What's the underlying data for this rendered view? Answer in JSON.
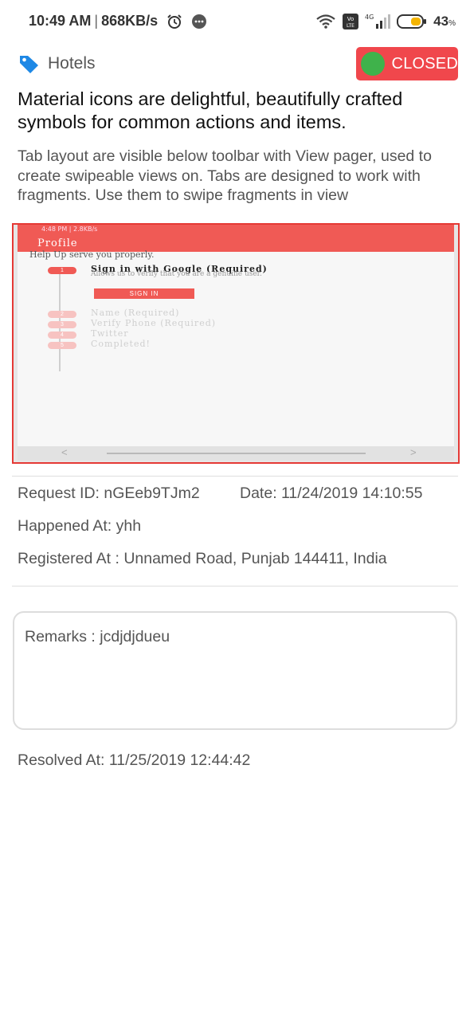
{
  "status_bar": {
    "time": "10:49 AM",
    "speed": "868KB/s",
    "network_badge": "Vo LTE",
    "network_type": "4G",
    "battery": "43",
    "battery_unit": "%"
  },
  "category": {
    "label": "Hotels",
    "icon": "label-tag-icon",
    "icon_color": "#1e88e5"
  },
  "status_chip": {
    "label": "CLOSED",
    "bg_color": "#f0474c",
    "dot_color": "#3fb24b"
  },
  "title": "Material icons are delightful, beautifully crafted symbols for common actions and items.",
  "description": "Tab layout are visible below toolbar with View pager, used to create swipeable views on. Tabs are designed to work with fragments. Use them to swipe fragments in view",
  "attachment": {
    "status_time": "4:48 PM | 2.8KB/s",
    "toolbar_title": "Profile",
    "subtitle": "Help Up serve you properly.",
    "steps": [
      {
        "num": "1",
        "label": "Sign in with Google (Required)"
      },
      {
        "num": "2",
        "label": "Name (Required)"
      },
      {
        "num": "3",
        "label": "Verify Phone (Required)"
      },
      {
        "num": "4",
        "label": "Twitter"
      },
      {
        "num": "5",
        "label": "Completed!"
      }
    ],
    "step_desc": "Allows us to verify that you are a genuine user.",
    "signin_label": "SIGN IN",
    "nav_prev": "<",
    "nav_next": ">"
  },
  "details": {
    "request_id": "Request ID: nGEeb9TJm2",
    "date": "Date: 11/24/2019 14:10:55",
    "happened_at": "Happened At: yhh",
    "registered_at": "Registered At : Unnamed Road, Punjab 144411, India"
  },
  "remarks": "Remarks : jcdjdjdueu",
  "resolved_at": "Resolved At: 11/25/2019 12:44:42"
}
